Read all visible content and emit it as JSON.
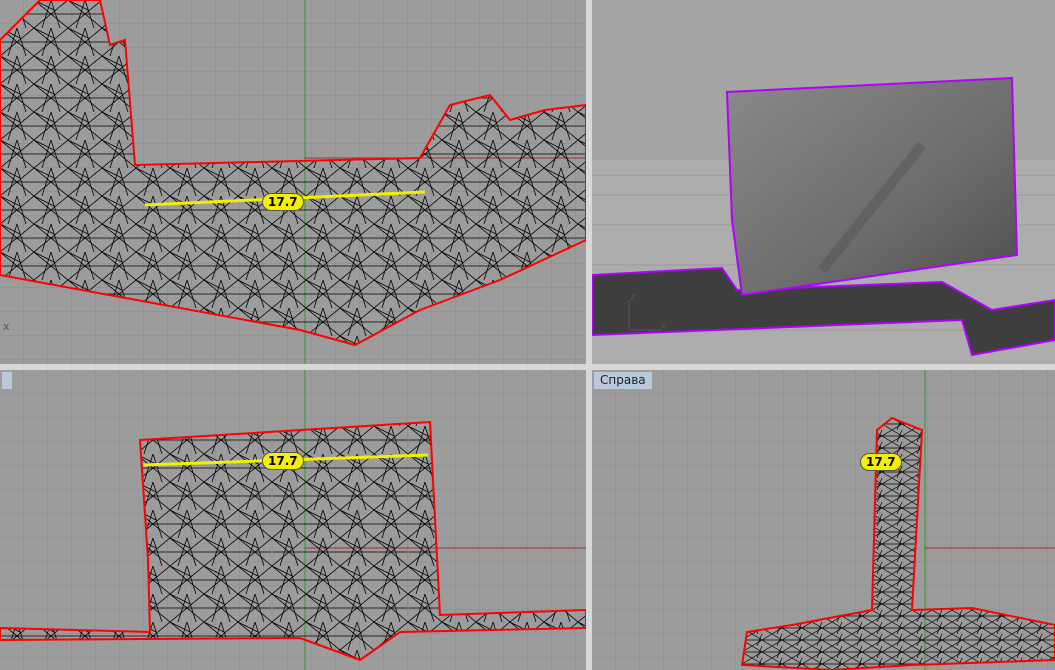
{
  "viewports": {
    "top_left": {
      "dimension": "17.7",
      "axis_label": "x"
    },
    "top_right": {
      "axis_z": "z",
      "axis_x": "x"
    },
    "bottom_left": {
      "label": "",
      "dimension": "17.7"
    },
    "bottom_right": {
      "label": "Справа",
      "dimension": "17.7"
    }
  },
  "colors": {
    "outline": "#ff0000",
    "dimension_line": "#f0f000",
    "mesh": "#000000",
    "grid": "#8a8a8a",
    "naked_edge": "#b000ff"
  }
}
